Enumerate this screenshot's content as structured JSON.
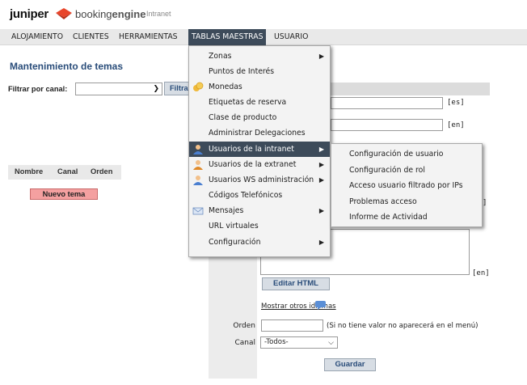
{
  "header": {
    "brand": "juniper",
    "product_light": "booking",
    "product_bold": "engine",
    "product_suffix": "Intranet",
    "brand_color": "#e8452a"
  },
  "topnav": {
    "items": [
      {
        "label": "ALOJAMIENTO",
        "active": false
      },
      {
        "label": "CLIENTES",
        "active": false
      },
      {
        "label": "HERRAMIENTAS",
        "active": false
      },
      {
        "label": "TABLAS MAESTRAS",
        "active": true
      },
      {
        "label": "USUARIO",
        "active": false
      }
    ]
  },
  "page": {
    "title": "Mantenimiento de temas",
    "filter_label": "Filtrar por canal:",
    "filter_value": "",
    "filter_button": "Filtrar"
  },
  "grid": {
    "columns": [
      "Nombre",
      "Canal",
      "Orden"
    ],
    "new_button": "Nuevo tema"
  },
  "form": {
    "lang_es": "[es]",
    "lang_en": "[en]",
    "lang_en_2": "[en]",
    "editar_html": "Editar HTML",
    "mostrar_otros": "Mostrar otros idiomas",
    "orden_label": "Orden",
    "orden_hint": "(Si no tiene valor no aparecerá en el menú)",
    "canal_label": "Canal",
    "canal_value": "-Todos-",
    "guardar": "Guardar"
  },
  "menu": {
    "items": [
      {
        "label": "Zonas",
        "arrow": true,
        "icon": ""
      },
      {
        "label": "Puntos de Interés",
        "arrow": false,
        "icon": ""
      },
      {
        "label": "Monedas",
        "arrow": false,
        "icon": "coins-icon"
      },
      {
        "label": "Etiquetas de reserva",
        "arrow": false,
        "icon": ""
      },
      {
        "label": "Clase de producto",
        "arrow": false,
        "icon": ""
      },
      {
        "label": "Administrar Delegaciones",
        "arrow": false,
        "icon": ""
      },
      {
        "label": "Usuarios de la intranet",
        "arrow": true,
        "icon": "user-icon",
        "highlighted": true
      },
      {
        "label": "Usuarios de la extranet",
        "arrow": true,
        "icon": "user-icon"
      },
      {
        "label": "Usuarios WS administración",
        "arrow": true,
        "icon": "user-icon"
      },
      {
        "label": "Códigos Telefónicos",
        "arrow": false,
        "icon": ""
      },
      {
        "label": "Mensajes",
        "arrow": true,
        "icon": "mail-icon"
      },
      {
        "label": "URL virtuales",
        "arrow": false,
        "icon": ""
      },
      {
        "label": "Configuración",
        "arrow": true,
        "icon": ""
      }
    ]
  },
  "submenu": {
    "items": [
      {
        "label": "Configuración de usuario"
      },
      {
        "label": "Configuración de rol"
      },
      {
        "label": "Acceso usuario filtrado por IPs"
      },
      {
        "label": "Problemas acceso"
      },
      {
        "label": "Informe de Actividad"
      }
    ]
  }
}
